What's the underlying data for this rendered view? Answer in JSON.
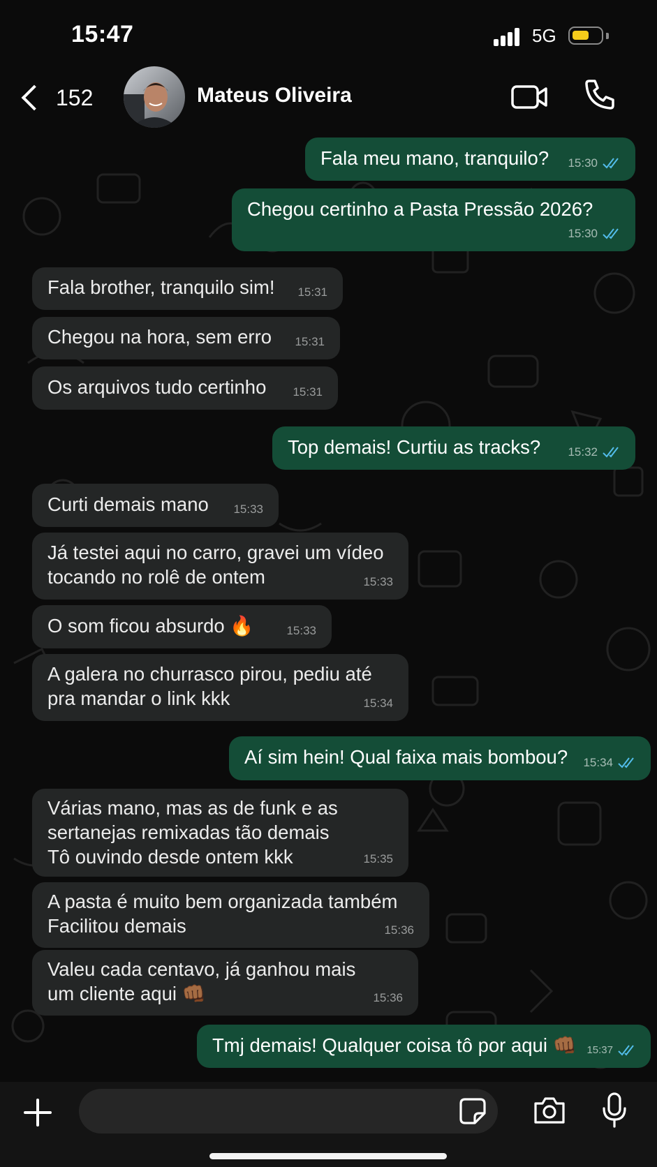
{
  "status_bar": {
    "time": "15:47",
    "network": "5G",
    "battery_level": 0.6,
    "battery_color": "#f5cc1b"
  },
  "header": {
    "back_count": "152",
    "contact_name": "Mateus Oliveira"
  },
  "colors": {
    "outgoing_bubble": "#144d37",
    "incoming_bubble": "#242626",
    "read_ticks": "#53bdeb",
    "background": "#0b0b0b"
  },
  "messages": [
    {
      "direction": "out",
      "text": "Fala meu mano, tranquilo?",
      "time": "15:30",
      "read": true
    },
    {
      "direction": "out",
      "text": "Chegou certinho a Pasta Pressão 2026?",
      "time": "15:30",
      "read": true
    },
    {
      "direction": "in",
      "text": "Fala brother, tranquilo sim!",
      "time": "15:31"
    },
    {
      "direction": "in",
      "text": "Chegou na hora, sem erro",
      "time": "15:31"
    },
    {
      "direction": "in",
      "text": "Os arquivos tudo certinho",
      "time": "15:31"
    },
    {
      "direction": "out",
      "text": "Top demais! Curtiu as tracks?",
      "time": "15:32",
      "read": true
    },
    {
      "direction": "in",
      "text": "Curti demais mano",
      "time": "15:33"
    },
    {
      "direction": "in",
      "text": "Já testei aqui no carro, gravei um vídeo\ntocando no rolê de ontem",
      "time": "15:33"
    },
    {
      "direction": "in",
      "text": "O som ficou absurdo 🔥",
      "time": "15:33"
    },
    {
      "direction": "in",
      "text": "A galera no churrasco pirou, pediu até\npra mandar o link kkk",
      "time": "15:34"
    },
    {
      "direction": "out",
      "text": "Aí sim hein! Qual faixa mais bombou?",
      "time": "15:34",
      "read": true
    },
    {
      "direction": "in",
      "text": "Várias mano, mas as de funk e as\nsertanejas remixadas tão demais\nTô ouvindo desde ontem kkk",
      "time": "15:35"
    },
    {
      "direction": "in",
      "text": "A pasta é muito bem organizada também\nFacilitou demais",
      "time": "15:36"
    },
    {
      "direction": "in",
      "text": "Valeu cada centavo, já ganhou mais\num cliente aqui 👊🏾",
      "time": "15:36"
    },
    {
      "direction": "out",
      "text": "Tmj demais! Qualquer coisa tô por aqui 👊🏾",
      "time": "15:37",
      "read": true
    }
  ],
  "input": {
    "placeholder": ""
  },
  "icons": {
    "back": "chevron-left-icon",
    "video": "video-camera-icon",
    "call": "phone-icon",
    "attach": "plus-icon",
    "sticker": "sticker-icon",
    "camera": "camera-icon",
    "mic": "microphone-icon"
  }
}
